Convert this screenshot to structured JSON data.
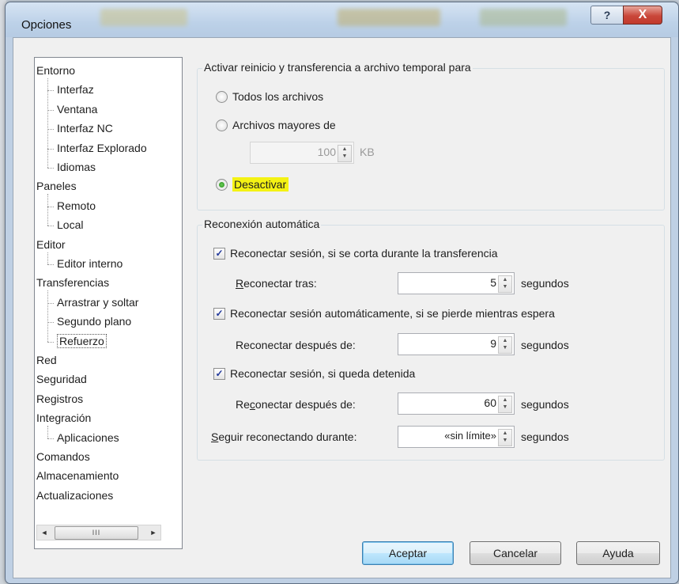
{
  "window": {
    "title": "Opciones",
    "help_label": "?",
    "close_label": "X"
  },
  "tree": {
    "items": [
      {
        "label": "Entorno",
        "level": 0
      },
      {
        "label": "Interfaz",
        "level": 1
      },
      {
        "label": "Ventana",
        "level": 1
      },
      {
        "label": "Interfaz NC",
        "level": 1
      },
      {
        "label": "Interfaz Explorado",
        "level": 1
      },
      {
        "label": "Idiomas",
        "level": 1
      },
      {
        "label": "Paneles",
        "level": 0
      },
      {
        "label": "Remoto",
        "level": 1
      },
      {
        "label": "Local",
        "level": 1
      },
      {
        "label": "Editor",
        "level": 0
      },
      {
        "label": "Editor interno",
        "level": 1
      },
      {
        "label": "Transferencias",
        "level": 0
      },
      {
        "label": "Arrastrar y soltar",
        "level": 1
      },
      {
        "label": "Segundo plano",
        "level": 1
      },
      {
        "label": "Refuerzo",
        "level": 1,
        "selected": true
      },
      {
        "label": "Red",
        "level": 0
      },
      {
        "label": "Seguridad",
        "level": 0
      },
      {
        "label": "Registros",
        "level": 0
      },
      {
        "label": "Integración",
        "level": 0
      },
      {
        "label": "Aplicaciones",
        "level": 1
      },
      {
        "label": "Comandos",
        "level": 0
      },
      {
        "label": "Almacenamiento",
        "level": 0
      },
      {
        "label": "Actualizaciones",
        "level": 0
      }
    ],
    "scroll_left": "◄",
    "scroll_right": "►",
    "scroll_thumb": "III"
  },
  "resume": {
    "group_label": "Activar reinicio y transferencia a archivo temporal para",
    "opt_all": "Todos los archivos",
    "opt_larger": "Archivos mayores de",
    "size_value": "100",
    "size_unit": "KB",
    "opt_disable": "Desactivar",
    "selected": "Desactivar"
  },
  "reconnect": {
    "group_label": "Reconexión automática",
    "chk1": {
      "label": "Reconectar sesión, si se corta durante la transferencia",
      "checked": true
    },
    "after_label_pre": "",
    "after_label_u": "R",
    "after_label_post": "econectar tras:",
    "after_value": "5",
    "chk2": {
      "label": "Reconectar sesión automáticamente, si se pierde mientras espera",
      "checked": true
    },
    "after2_label": "Reconectar después de:",
    "after2_value": "9",
    "chk3": {
      "label": "Reconectar sesión, si queda detenida",
      "checked": true
    },
    "after3_pre": "Re",
    "after3_u": "c",
    "after3_post": "onectar después de:",
    "after3_value": "60",
    "keep_u": "S",
    "keep_post": "eguir reconectando durante:",
    "keep_value": "«sin límite»",
    "unit": "segundos"
  },
  "buttons": {
    "ok": "Aceptar",
    "cancel": "Cancelar",
    "help": "Ayuda"
  },
  "colors": {
    "highlight": "#f4f214",
    "close": "#c9473a"
  }
}
